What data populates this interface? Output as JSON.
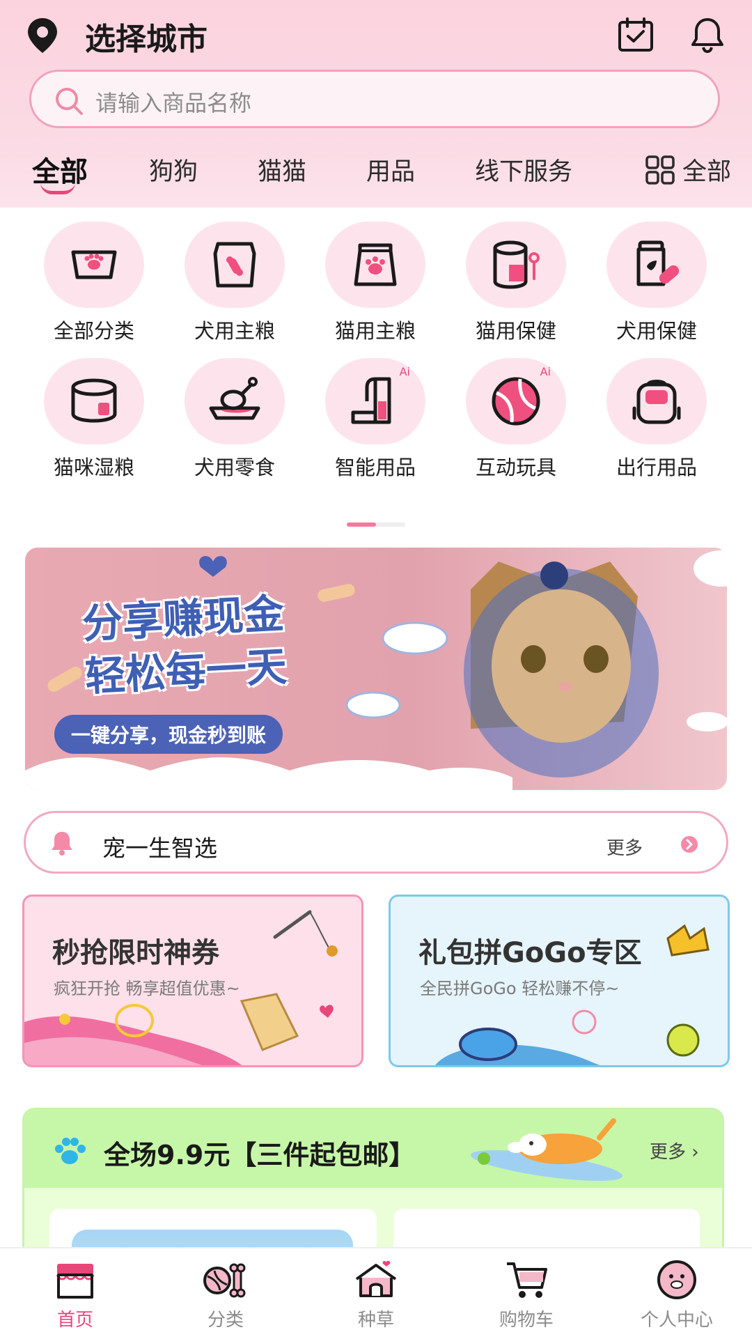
{
  "header": {
    "city": "选择城市",
    "search_placeholder": "请输入商品名称",
    "tabs": [
      {
        "label": "全部",
        "active": true
      },
      {
        "label": "狗狗"
      },
      {
        "label": "猫猫"
      },
      {
        "label": "用品"
      },
      {
        "label": "线下服务"
      }
    ],
    "all_label": "全部"
  },
  "categories": [
    {
      "label": "全部分类",
      "icon": "cat-tray-icon"
    },
    {
      "label": "犬用主粮",
      "icon": "dog-food-bag-icon"
    },
    {
      "label": "猫用主粮",
      "icon": "cat-food-bag-icon"
    },
    {
      "label": "猫用保健",
      "icon": "supplement-jar-icon"
    },
    {
      "label": "犬用保健",
      "icon": "pill-bottle-icon"
    },
    {
      "label": "猫咪湿粮",
      "icon": "wet-food-can-icon"
    },
    {
      "label": "犬用零食",
      "icon": "dog-snack-icon"
    },
    {
      "label": "智能用品",
      "icon": "smart-feeder-icon",
      "badge": "Ai"
    },
    {
      "label": "互动玩具",
      "icon": "toy-ball-icon",
      "badge": "Ai"
    },
    {
      "label": "出行用品",
      "icon": "backpack-icon"
    }
  ],
  "banner": {
    "title_line1": "分享赚现金",
    "title_line2": "轻松每一天",
    "pill": "一键分享，现金秒到账"
  },
  "notice": {
    "text": "宠一生智选",
    "more": "更多"
  },
  "cards": [
    {
      "title": "秒抢限时神券",
      "subtitle": "疯狂开抢  畅享超值优惠~"
    },
    {
      "title": "礼包拼GoGo专区",
      "subtitle": "全民拼GoGo  轻松赚不停~"
    }
  ],
  "promo": {
    "title": "全场9.9元【三件起包邮】",
    "more": "更多"
  },
  "tabbar": [
    {
      "label": "首页",
      "active": true
    },
    {
      "label": "分类"
    },
    {
      "label": "种草"
    },
    {
      "label": "购物车"
    },
    {
      "label": "个人中心"
    }
  ],
  "colors": {
    "accent": "#e9467a",
    "header_bg": "#fbd3df",
    "promo_bg": "#c6f7a8"
  }
}
